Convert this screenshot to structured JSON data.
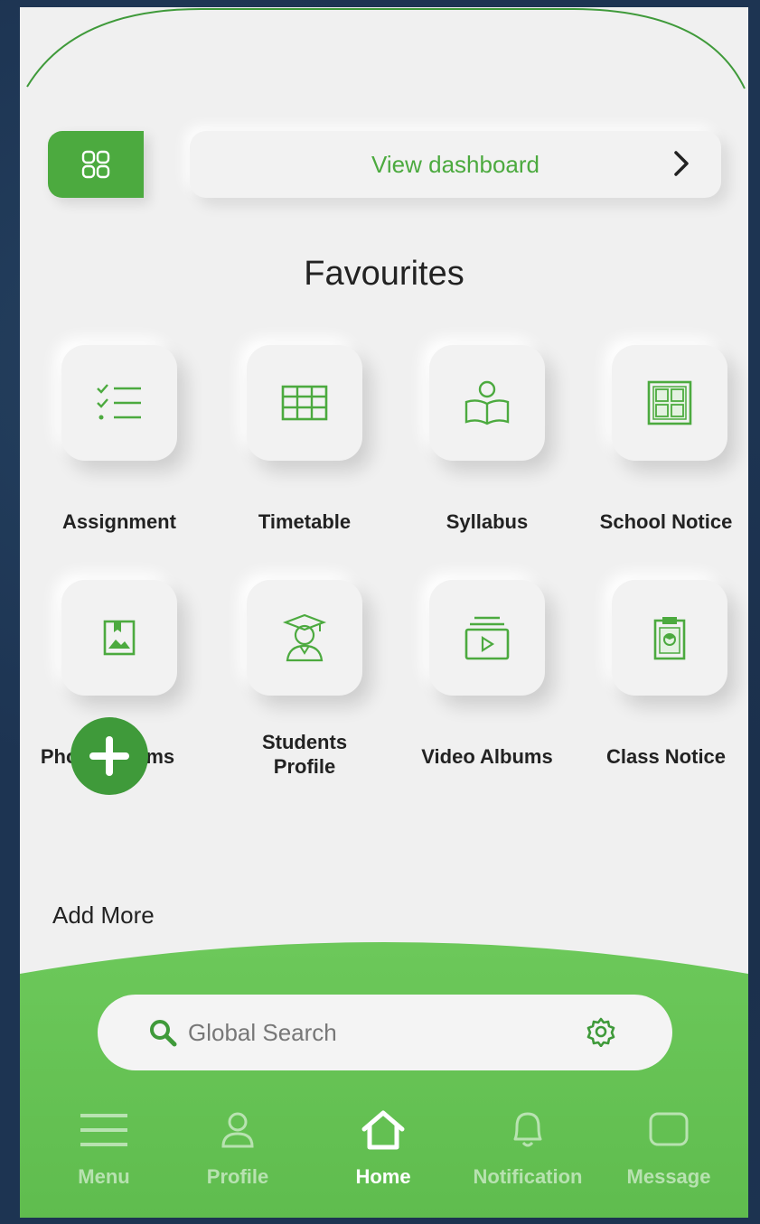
{
  "colors": {
    "accent": "#4caa3f",
    "accent_dark": "#3f9a3a",
    "background": "#f0f0f0",
    "nav_green": "#67c255"
  },
  "dashboard": {
    "view_label": "View dashboard",
    "grid_icon": "grid-icon",
    "chevron_icon": "chevron-right-icon"
  },
  "favourites": {
    "title": "Favourites",
    "items": [
      {
        "label": "Assignment",
        "icon": "checklist-icon"
      },
      {
        "label": "Timetable",
        "icon": "table-icon"
      },
      {
        "label": "Syllabus",
        "icon": "open-book-icon"
      },
      {
        "label": "School Notice",
        "icon": "notice-board-icon"
      },
      {
        "label": "Photo Albums",
        "icon": "photo-album-icon"
      },
      {
        "label": "Students Profile",
        "icon": "graduate-icon"
      },
      {
        "label": "Video Albums",
        "icon": "video-album-icon"
      },
      {
        "label": "Class Notice",
        "icon": "clipboard-icon"
      }
    ],
    "add_more_label": "Add More"
  },
  "search": {
    "placeholder": "Global Search"
  },
  "nav": {
    "items": [
      {
        "label": "Menu",
        "icon": "hamburger-icon"
      },
      {
        "label": "Profile",
        "icon": "user-icon"
      },
      {
        "label": "Home",
        "icon": "home-icon",
        "active": true
      },
      {
        "label": "Notification",
        "icon": "bell-icon"
      },
      {
        "label": "Message",
        "icon": "message-icon"
      }
    ]
  }
}
